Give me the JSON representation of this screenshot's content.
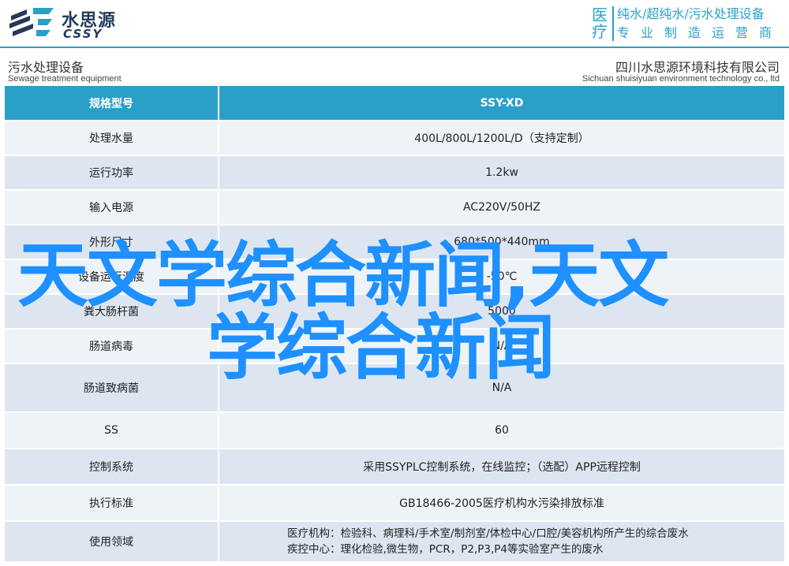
{
  "header": {
    "logo_cn": "水思源",
    "logo_en": "CSSY",
    "medical_chars": [
      "医",
      "疗"
    ],
    "tagline_1": "纯水/超纯水/污水处理设备",
    "tagline_2": "专业制造运营商",
    "accent_color": "#2aa0c8"
  },
  "subheader": {
    "left_cn": "污水处理设备",
    "left_en": "Sewage treatment equipment",
    "right_cn": "四川水思源环境科技有限公司",
    "right_en": "Sichuan shuisiyuan environment technology co., ltd"
  },
  "table": {
    "header": {
      "key": "规格型号",
      "value": "SSY-XD"
    },
    "rows": [
      {
        "key": "处理水量",
        "value": "400L/800L/1200L/D（支持定制）"
      },
      {
        "key": "运行功率",
        "value": "1.2kw"
      },
      {
        "key": "输入电源",
        "value": "AC220V/50HZ"
      },
      {
        "key": "外形尺寸",
        "value": "680*500*440mm"
      },
      {
        "key": "设备运行温度",
        "value": "-50℃"
      },
      {
        "key": "粪大肠杆菌",
        "value": "5000"
      },
      {
        "key": "肠道病毒",
        "value": "N/A"
      },
      {
        "key": "肠道致病菌",
        "value": "N/A"
      },
      {
        "key": "SS",
        "value": "60"
      },
      {
        "key": "控制系统",
        "value": "采用SSYPLC控制系统，在线监控；（选配）APP远程控制"
      },
      {
        "key": "执行标准",
        "value": "GB18466-2005医疗机构水污染排放标准"
      },
      {
        "key": "使用领域",
        "value_lines": [
          "医疗机构：检验科、病理科/手术室/制剂室/体检中心/口腔/美容机构所产生的综合废水",
          "疾控中心：理化检验,微生物，PCR，P2,P3,P4等实验室产生的废水"
        ]
      }
    ]
  },
  "watermark": {
    "line1": "天文学综合新闻,天文",
    "line2": "学综合新闻",
    "color": "#1e90ff"
  }
}
